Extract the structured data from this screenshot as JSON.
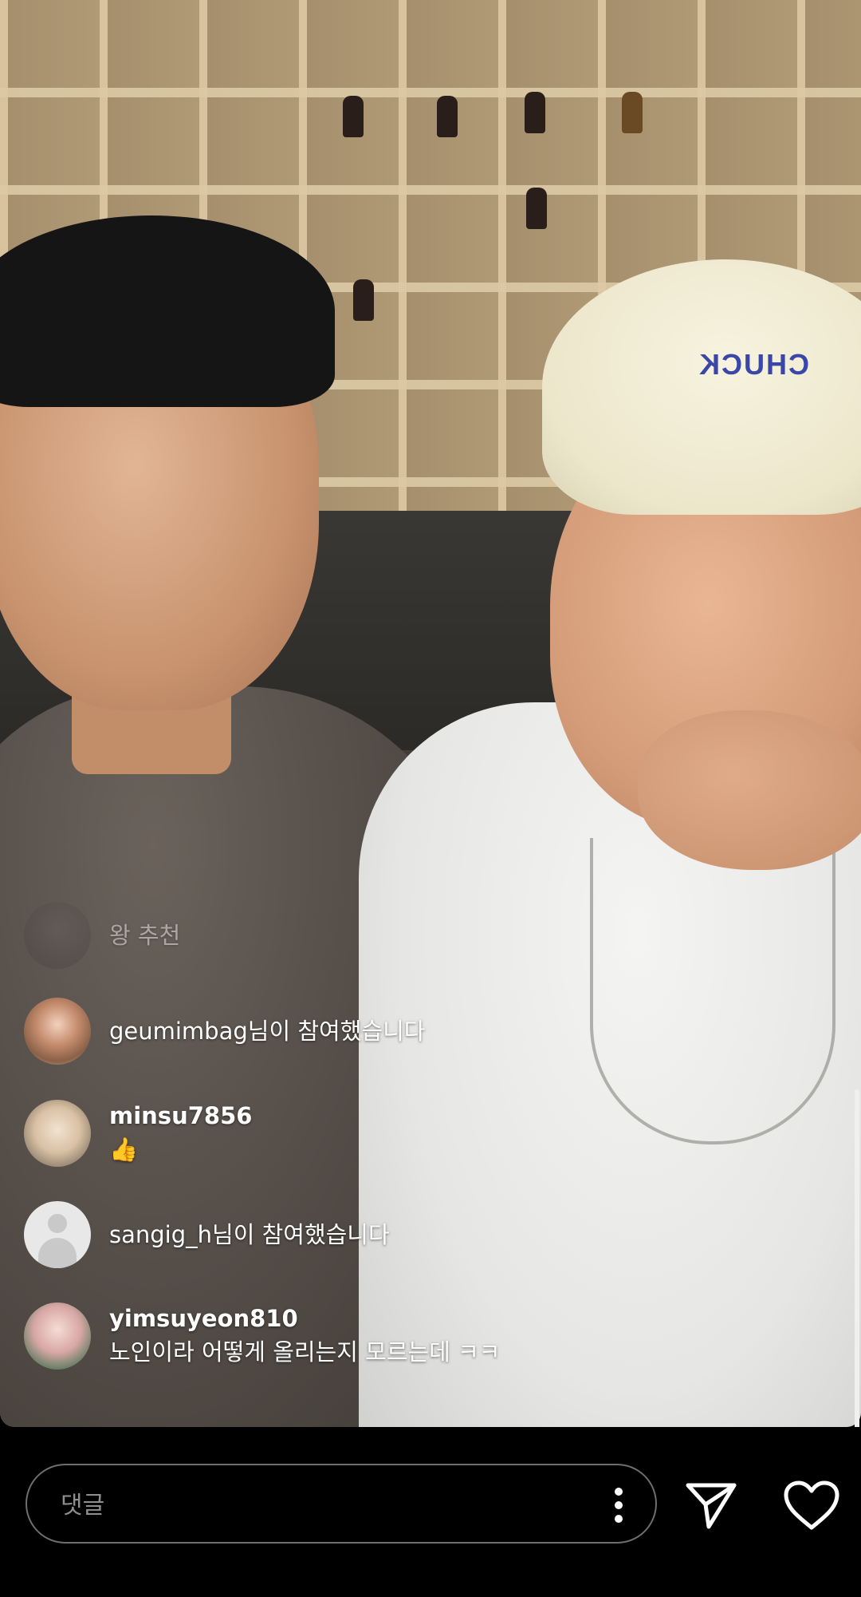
{
  "video": {
    "cap_text": "CHUCK"
  },
  "comments": [
    {
      "kind": "faded",
      "avatar": "a4",
      "text": "왕 추천"
    },
    {
      "kind": "join",
      "avatar": "a1",
      "text": "geumimbag님이 참여했습니다"
    },
    {
      "kind": "comment",
      "avatar": "a2",
      "user": "minsu7856",
      "body": "👍"
    },
    {
      "kind": "join",
      "avatar": "default",
      "text": "sangig_h님이 참여했습니다"
    },
    {
      "kind": "comment",
      "avatar": "a3",
      "user": "yimsuyeon810",
      "body": "노인이라 어떻게 올리는지 모르는데 ㅋㅋ"
    }
  ],
  "composer": {
    "placeholder": "댓글",
    "more_icon": "more-vertical-icon",
    "send_icon": "paper-plane-icon",
    "like_icon": "heart-icon"
  },
  "colors": {
    "background": "#000000",
    "text": "#ffffff",
    "placeholder": "#8f8f8f",
    "input_border": "#6e6e6e"
  }
}
